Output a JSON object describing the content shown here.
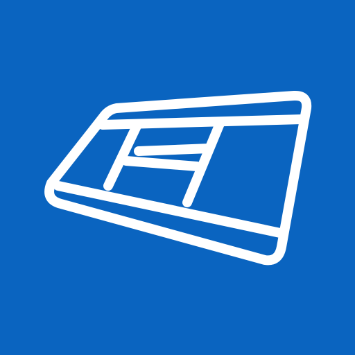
{
  "icon": {
    "name": "tilted-window-layout-icon",
    "colors": {
      "background": "#0a64c0",
      "stroke": "#ffffff"
    }
  }
}
